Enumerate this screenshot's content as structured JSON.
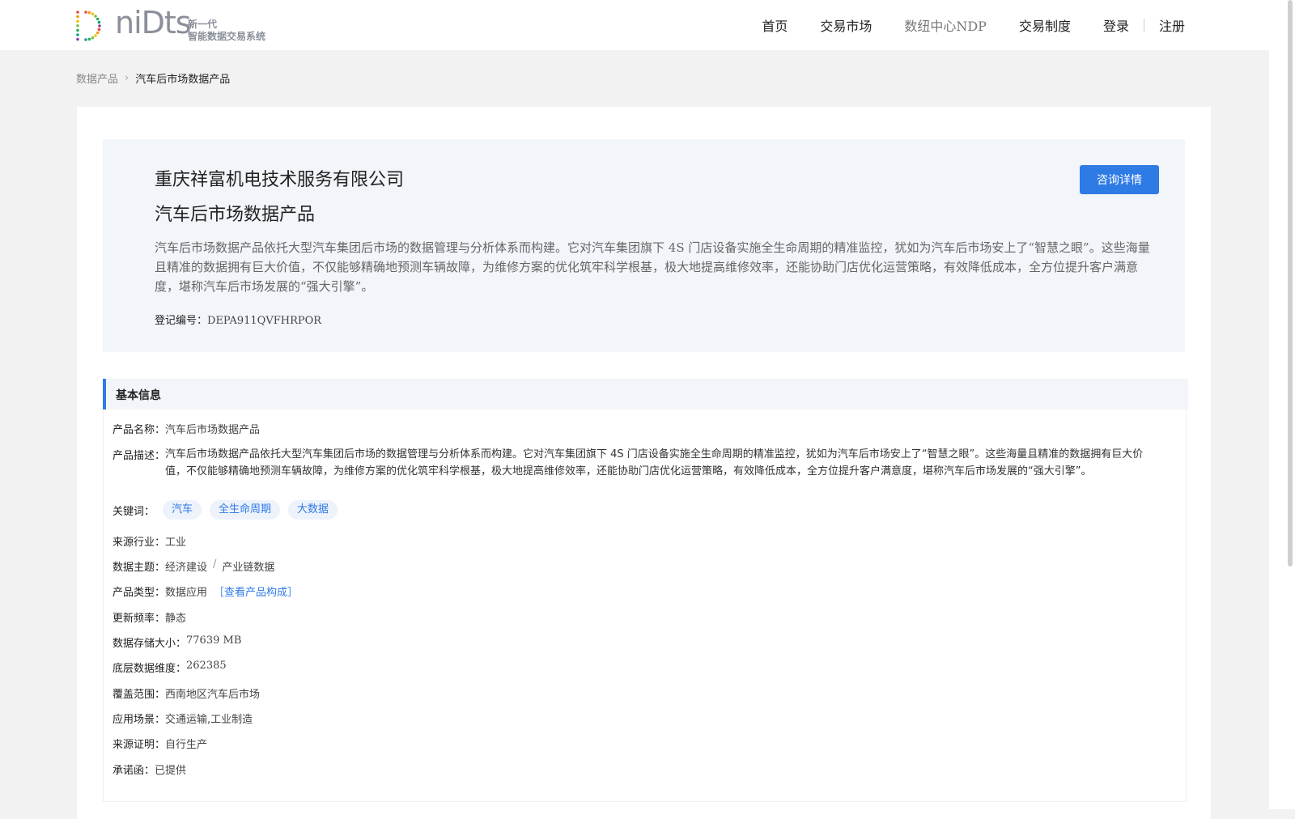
{
  "header": {
    "logo_word": "niDts",
    "logo_sub1": "新一代",
    "logo_sub2": "智能数据交易系统",
    "nav": {
      "home": "首页",
      "market": "交易市场",
      "ndp": "数纽中心NDP",
      "rules": "交易制度",
      "login": "登录",
      "register": "注册"
    }
  },
  "breadcrumb": {
    "parent": "数据产品",
    "current": "汽车后市场数据产品"
  },
  "hero": {
    "company": "重庆祥富机电技术服务有限公司",
    "product": "汽车后市场数据产品",
    "consult_button": "咨询详情",
    "description": "汽车后市场数据产品依托大型汽车集团后市场的数据管理与分析体系而构建。它对汽车集团旗下 4S 门店设备实施全生命周期的精准监控，犹如为汽车后市场安上了“智慧之眼”。这些海量且精准的数据拥有巨大价值，不仅能够精确地预测车辆故障，为维修方案的优化筑牢科学根基，极大地提高维修效率，还能协助门店优化运营策略，有效降低成本，全方位提升客户满意度，堪称汽车后市场发展的“强大引擎”。",
    "reg_label": "登记编号：",
    "reg_value": "DEPA911QVFHRPOR"
  },
  "basic_info": {
    "title": "基本信息",
    "product_name": {
      "label": "产品名称：",
      "value": "汽车后市场数据产品"
    },
    "product_desc": {
      "label": "产品描述：",
      "value": "汽车后市场数据产品依托大型汽车集团后市场的数据管理与分析体系而构建。它对汽车集团旗下 4S 门店设备实施全生命周期的精准监控，犹如为汽车后市场安上了“智慧之眼”。这些海量且精准的数据拥有巨大价值，不仅能够精确地预测车辆故障，为维修方案的优化筑牢科学根基，极大地提高维修效率，还能协助门店优化运营策略，有效降低成本，全方位提升客户满意度，堪称汽车后市场发展的“强大引擎”。"
    },
    "keywords": {
      "label": "关键词：",
      "tags": [
        "汽车",
        "全生命周期",
        "大数据"
      ]
    },
    "industry": {
      "label": "来源行业：",
      "value": "工业"
    },
    "theme": {
      "label": "数据主题：",
      "value1": "经济建设",
      "sep": "/",
      "value2": "产业链数据"
    },
    "product_type": {
      "label": "产品类型：",
      "value": "数据应用",
      "link": "［查看产品构成］"
    },
    "frequency": {
      "label": "更新频率：",
      "value": "静态"
    },
    "storage": {
      "label": "数据存储大小：",
      "value": "77639 MB"
    },
    "dimension": {
      "label": "底层数据维度：",
      "value": "262385"
    },
    "coverage": {
      "label": "覆盖范围：",
      "value": "西南地区汽车后市场"
    },
    "scenario": {
      "label": "应用场景：",
      "value": "交通运输,工业制造"
    },
    "proof": {
      "label": "来源证明：",
      "value": "自行生产"
    },
    "promise": {
      "label": "承诺函：",
      "value": "已提供"
    }
  }
}
